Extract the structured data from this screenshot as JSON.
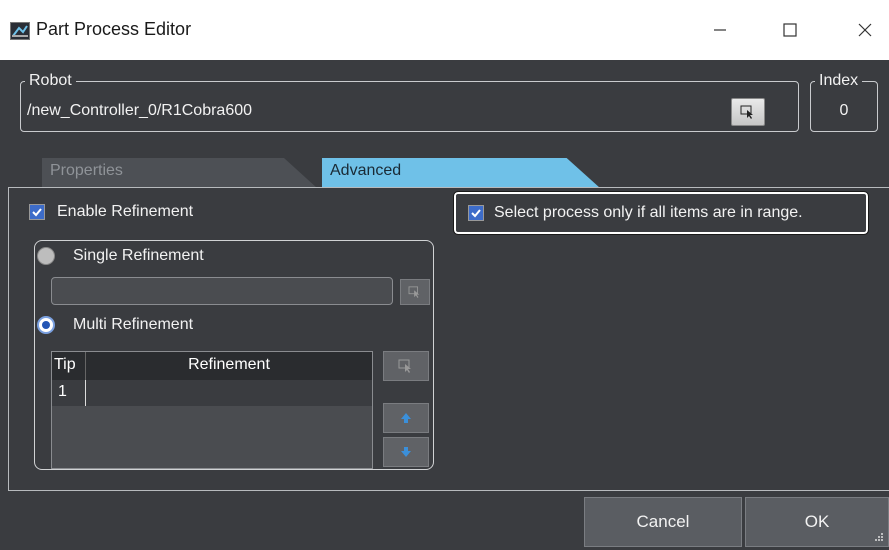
{
  "window": {
    "title": "Part Process Editor",
    "controls": [
      "minimize",
      "maximize",
      "close"
    ]
  },
  "robot": {
    "label": "Robot",
    "path": "/new_Controller_0/R1Cobra600"
  },
  "index": {
    "label": "Index",
    "value": "0"
  },
  "tabs": [
    {
      "label": "Properties",
      "active": false
    },
    {
      "label": "Advanced",
      "active": true
    }
  ],
  "advanced": {
    "enable_refinement": {
      "label": "Enable Refinement",
      "checked": true
    },
    "select_process": {
      "label": "Select process only if all items are in range.",
      "checked": true
    },
    "single_refinement": {
      "label": "Single Refinement",
      "selected": false,
      "value": ""
    },
    "multi_refinement": {
      "label": "Multi Refinement",
      "selected": true
    },
    "table": {
      "columns": [
        "Tip",
        "Refinement"
      ],
      "rows": [
        [
          "1",
          ""
        ]
      ]
    }
  },
  "buttons": {
    "cancel": "Cancel",
    "ok": "OK"
  },
  "colors": {
    "background": "#3a3c40",
    "active_tab": "#6fc1e8",
    "inactive_tab": "#4d5055",
    "checkbox_fill": "#3d6cc9"
  },
  "icons": {
    "app": "app-icon",
    "pick": "pointer-select-icon",
    "up": "arrow-up-icon",
    "down": "arrow-down-icon"
  }
}
